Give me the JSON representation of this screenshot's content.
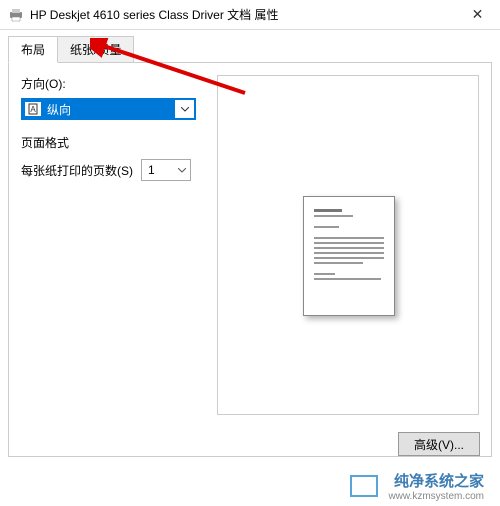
{
  "window": {
    "title": "HP Deskjet 4610 series Class Driver 文档 属性",
    "close": "✕"
  },
  "tabs": {
    "layout": "布局",
    "paper_quality": "纸张/质量"
  },
  "orientation": {
    "label": "方向(O):",
    "value": "纵向"
  },
  "page_format": {
    "section": "页面格式",
    "pages_per_sheet_label": "每张纸打印的页数(S)",
    "pages_per_sheet_value": "1"
  },
  "buttons": {
    "advanced": "高级(V)..."
  },
  "watermark": {
    "title": "纯净系统之家",
    "url": "www.kzmsystem.com"
  }
}
